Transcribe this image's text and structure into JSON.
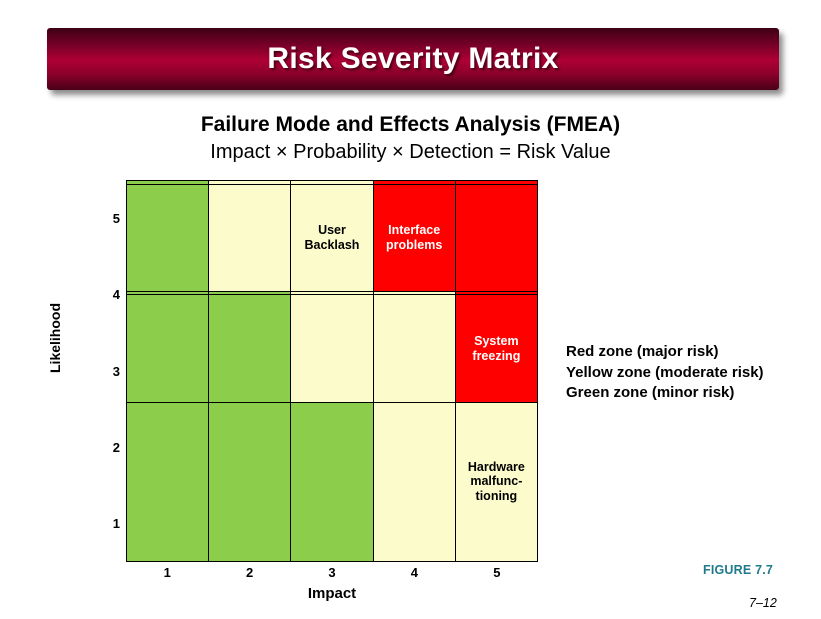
{
  "banner": {
    "title": "Risk Severity Matrix"
  },
  "headings": {
    "title": "Failure Mode and Effects Analysis (FMEA)",
    "subtitle": "Impact × Probability × Detection = Risk Value"
  },
  "axes": {
    "y_title": "Likelihood",
    "x_title": "Impact",
    "y_ticks": [
      "5",
      "4",
      "3",
      "2",
      "1"
    ],
    "x_ticks": [
      "1",
      "2",
      "3",
      "4",
      "5"
    ]
  },
  "legend": {
    "lines": [
      "Red zone (major risk)",
      "Yellow zone (moderate risk)",
      "Green zone (minor risk)"
    ]
  },
  "footer": {
    "figure": "FIGURE 7.7",
    "slide_number": "7–12"
  },
  "colors": {
    "green": "#8CCE4C",
    "yellow": "#FCFBCB",
    "red": "#FF0000",
    "banner_dark": "#3D0014",
    "banner_bright": "#AE0035",
    "figure_teal": "#1F7A8C"
  },
  "chart_data": {
    "type": "heatmap",
    "title": "Failure Mode and Effects Analysis (FMEA)",
    "subtitle": "Impact × Probability × Detection = Risk Value",
    "xlabel": "Impact",
    "ylabel": "Likelihood",
    "x": [
      "1",
      "2",
      "3",
      "4",
      "5"
    ],
    "y": [
      "5",
      "4",
      "3",
      "2",
      "1"
    ],
    "grid": true,
    "legend_position": "right",
    "zone_legend": [
      {
        "zone": "red",
        "label": "Red zone (major risk)",
        "color": "#FF0000"
      },
      {
        "zone": "yellow",
        "label": "Yellow zone (moderate risk)",
        "color": "#FCFBCB"
      },
      {
        "zone": "green",
        "label": "Green zone (minor risk)",
        "color": "#8CCE4C"
      }
    ],
    "rows": [
      {
        "likelihood": "5",
        "cells": [
          {
            "impact": "1",
            "zone": "green",
            "label": "",
            "text_color": "dark"
          },
          {
            "impact": "2",
            "zone": "yellow",
            "label": "",
            "text_color": "dark"
          },
          {
            "impact": "3",
            "zone": "yellow",
            "label": "",
            "text_color": "dark"
          },
          {
            "impact": "4",
            "zone": "red",
            "label": "",
            "text_color": "light"
          },
          {
            "impact": "5",
            "zone": "red",
            "label": "",
            "text_color": "light"
          }
        ]
      },
      {
        "likelihood": "4",
        "cells": [
          {
            "impact": "1",
            "zone": "green",
            "label": "",
            "text_color": "dark"
          },
          {
            "impact": "2",
            "zone": "yellow",
            "label": "",
            "text_color": "dark"
          },
          {
            "impact": "3",
            "zone": "yellow",
            "label": "User\nBacklash",
            "text_color": "dark"
          },
          {
            "impact": "4",
            "zone": "red",
            "label": "Interface\nproblems",
            "text_color": "light"
          },
          {
            "impact": "5",
            "zone": "red",
            "label": "",
            "text_color": "light"
          }
        ]
      },
      {
        "likelihood": "3",
        "cells": [
          {
            "impact": "1",
            "zone": "green",
            "label": "",
            "text_color": "dark"
          },
          {
            "impact": "2",
            "zone": "green",
            "label": "",
            "text_color": "dark"
          },
          {
            "impact": "3",
            "zone": "yellow",
            "label": "",
            "text_color": "dark"
          },
          {
            "impact": "4",
            "zone": "yellow",
            "label": "",
            "text_color": "dark"
          },
          {
            "impact": "5",
            "zone": "red",
            "label": "",
            "text_color": "light"
          }
        ]
      },
      {
        "likelihood": "2",
        "cells": [
          {
            "impact": "1",
            "zone": "green",
            "label": "",
            "text_color": "dark"
          },
          {
            "impact": "2",
            "zone": "green",
            "label": "",
            "text_color": "dark"
          },
          {
            "impact": "3",
            "zone": "yellow",
            "label": "",
            "text_color": "dark"
          },
          {
            "impact": "4",
            "zone": "yellow",
            "label": "",
            "text_color": "dark"
          },
          {
            "impact": "5",
            "zone": "red",
            "label": "System\nfreezing",
            "text_color": "light"
          }
        ]
      },
      {
        "likelihood": "1",
        "cells": [
          {
            "impact": "1",
            "zone": "green",
            "label": "",
            "text_color": "dark"
          },
          {
            "impact": "2",
            "zone": "green",
            "label": "",
            "text_color": "dark"
          },
          {
            "impact": "3",
            "zone": "green",
            "label": "",
            "text_color": "dark"
          },
          {
            "impact": "4",
            "zone": "yellow",
            "label": "",
            "text_color": "dark"
          },
          {
            "impact": "5",
            "zone": "yellow",
            "label": "Hardware\nmalfunc-\ntioning",
            "text_color": "dark"
          }
        ]
      }
    ]
  }
}
